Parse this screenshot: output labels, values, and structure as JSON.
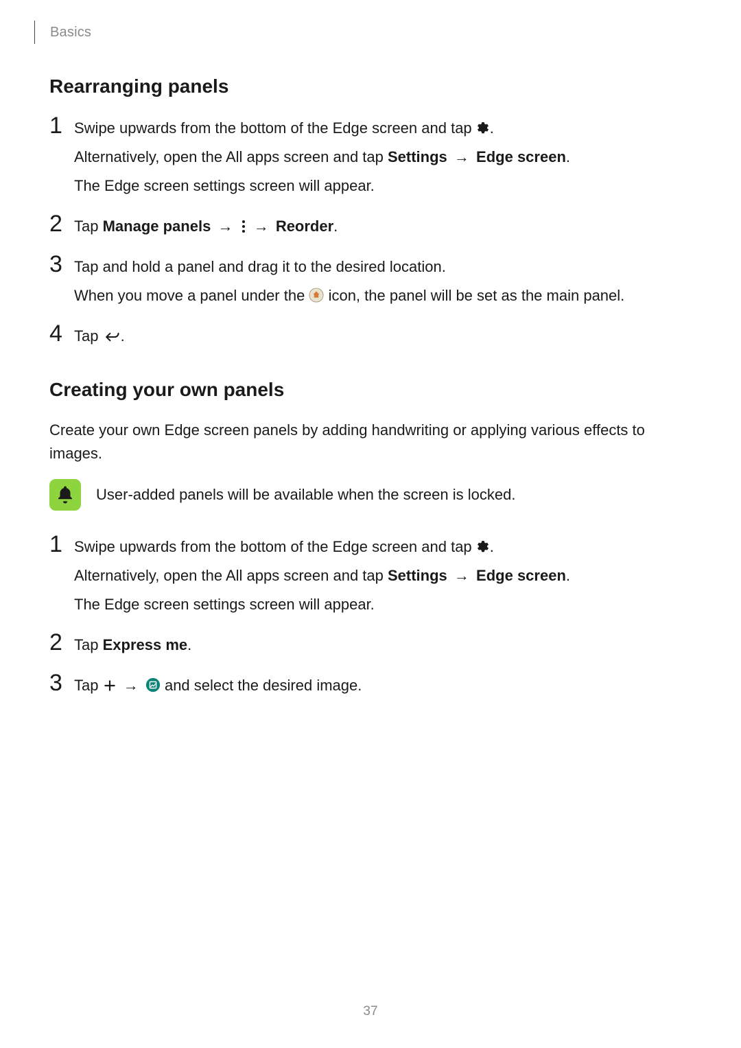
{
  "header": {
    "section": "Basics"
  },
  "page_number": "37",
  "arrow": "→",
  "rearranging": {
    "title": "Rearranging panels",
    "step1": {
      "p1a": "Swipe upwards from the bottom of the Edge screen and tap ",
      "p1c": ".",
      "p2a": "Alternatively, open the All apps screen and tap ",
      "p2b": "Settings",
      "p2d": "Edge screen",
      "p2e": ".",
      "p3": "The Edge screen settings screen will appear."
    },
    "step2": {
      "a": "Tap ",
      "b": "Manage panels",
      "d": "Reorder",
      "e": "."
    },
    "step3": {
      "p1": "Tap and hold a panel and drag it to the desired location.",
      "p2a": "When you move a panel under the ",
      "p2b": " icon, the panel will be set as the main panel."
    },
    "step4": {
      "a": "Tap ",
      "b": "."
    }
  },
  "creating": {
    "title": "Creating your own panels",
    "intro": "Create your own Edge screen panels by adding handwriting or applying various effects to images.",
    "note": "User-added panels will be available when the screen is locked.",
    "step1": {
      "p1a": "Swipe upwards from the bottom of the Edge screen and tap ",
      "p1c": ".",
      "p2a": "Alternatively, open the All apps screen and tap ",
      "p2b": "Settings",
      "p2d": "Edge screen",
      "p2e": ".",
      "p3": "The Edge screen settings screen will appear."
    },
    "step2": {
      "a": "Tap ",
      "b": "Express me",
      "c": "."
    },
    "step3": {
      "a": "Tap ",
      "b": " and select the desired image."
    }
  }
}
